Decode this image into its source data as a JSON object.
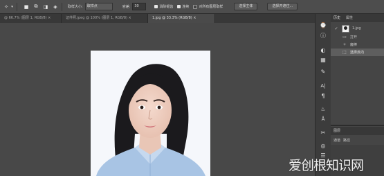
{
  "options_bar": {
    "style_label": "取样大小:",
    "style_value": "取样点",
    "tolerance_label": "容差:",
    "tolerance_value": "30",
    "antialias_label": "消除锯齿",
    "contiguous_label": "连续",
    "all_layers_label": "对所有图层取样",
    "select_subject_label": "选择主体",
    "select_and_mask_label": "选择并遮住..."
  },
  "document_tabs": [
    {
      "label": "@ 66.7% (图层 1, RGB/8) ×",
      "active": false
    },
    {
      "label": "证件照.jpeg @ 100% (图层 1, RGB/8) ×",
      "active": false
    },
    {
      "label": "1.jpg @ 33.3% (RGB/8) ×",
      "active": true
    }
  ],
  "panels": {
    "top_tabs": [
      "历史",
      "属性"
    ],
    "history_snapshot": "1.jpg",
    "history_items": [
      {
        "label": "打开",
        "selected": false
      },
      {
        "label": "魔棒",
        "selected": false
      },
      {
        "label": "选择反向",
        "selected": true
      }
    ],
    "layers_header": "图层",
    "layers_tabs": [
      "通道",
      "路径"
    ]
  },
  "right_strip_icons": [
    "history-icon",
    "info-icon",
    "color-icon",
    "swatches-icon",
    "brush-icon",
    "character-icon",
    "paragraph-icon",
    "clone-icon",
    "glyph-icon",
    "tools-icon",
    "adjust-icon",
    "layers-icon"
  ],
  "colors": {
    "accent": "#e5e5e5",
    "background": "#4a4a4a"
  },
  "watermark": "爱创根知识网"
}
